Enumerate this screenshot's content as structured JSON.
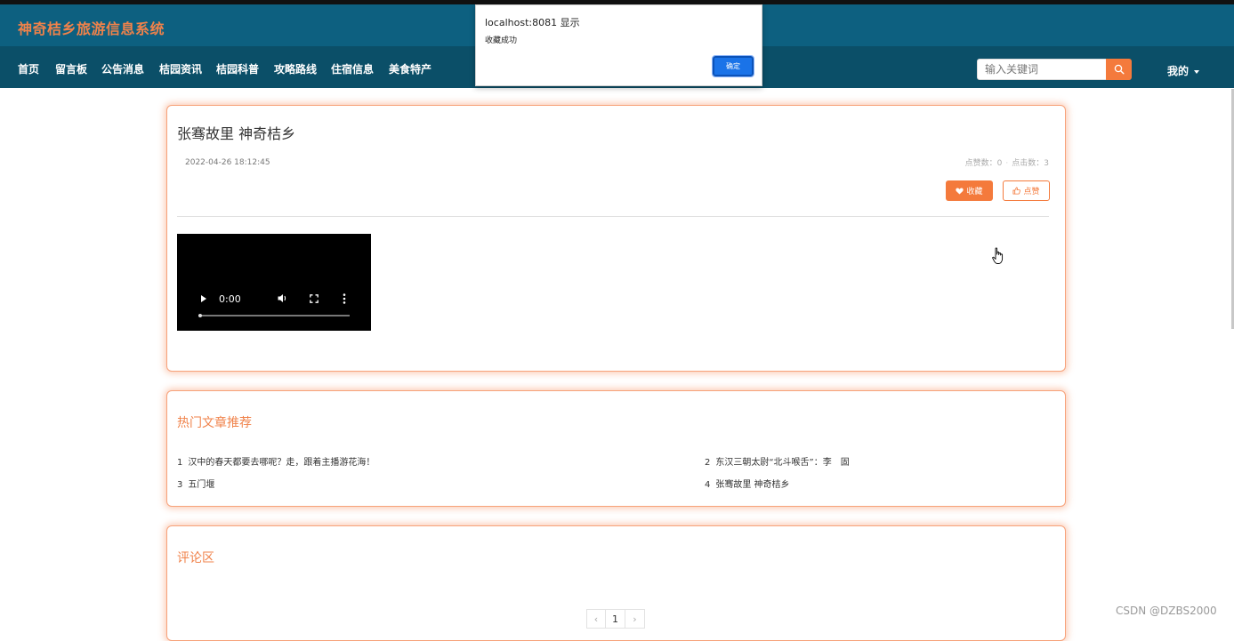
{
  "header": {
    "site_title": "神奇桔乡旅游信息系统"
  },
  "nav": {
    "items": [
      "首页",
      "留言板",
      "公告消息",
      "桔园资讯",
      "桔园科普",
      "攻略路线",
      "住宿信息",
      "美食特产"
    ],
    "search_placeholder": "输入关键词",
    "user_menu": "我的"
  },
  "article": {
    "title": "张骞故里 神奇桔乡",
    "date": "2022-04-26 18:12:45",
    "likes_label": "点赞数：0",
    "clicks_label": "点击数：3",
    "favorite_button": "收藏",
    "like_button": "点赞",
    "video_time": "0:00"
  },
  "hot": {
    "title": "热门文章推荐",
    "items": [
      {
        "num": "1",
        "title": "汉中的春天都要去哪呢？走，跟着主播游花海！"
      },
      {
        "num": "2",
        "title": "东汉三朝太尉“北斗喉舌”：李　固"
      },
      {
        "num": "3",
        "title": "五门堰"
      },
      {
        "num": "4",
        "title": "张骞故里 神奇桔乡"
      }
    ]
  },
  "comments": {
    "title": "评论区",
    "pager": {
      "prev": "‹",
      "current": "1",
      "next": "›"
    }
  },
  "dialog": {
    "title": "localhost:8081 显示",
    "message": "收藏成功",
    "ok_button": "确定"
  },
  "watermark": "CSDN @DZBS2000",
  "colors": {
    "header": "#0d6080",
    "navbar": "#0b4f68",
    "accent": "#f47a3c",
    "dialog_button": "#1a73e8"
  }
}
